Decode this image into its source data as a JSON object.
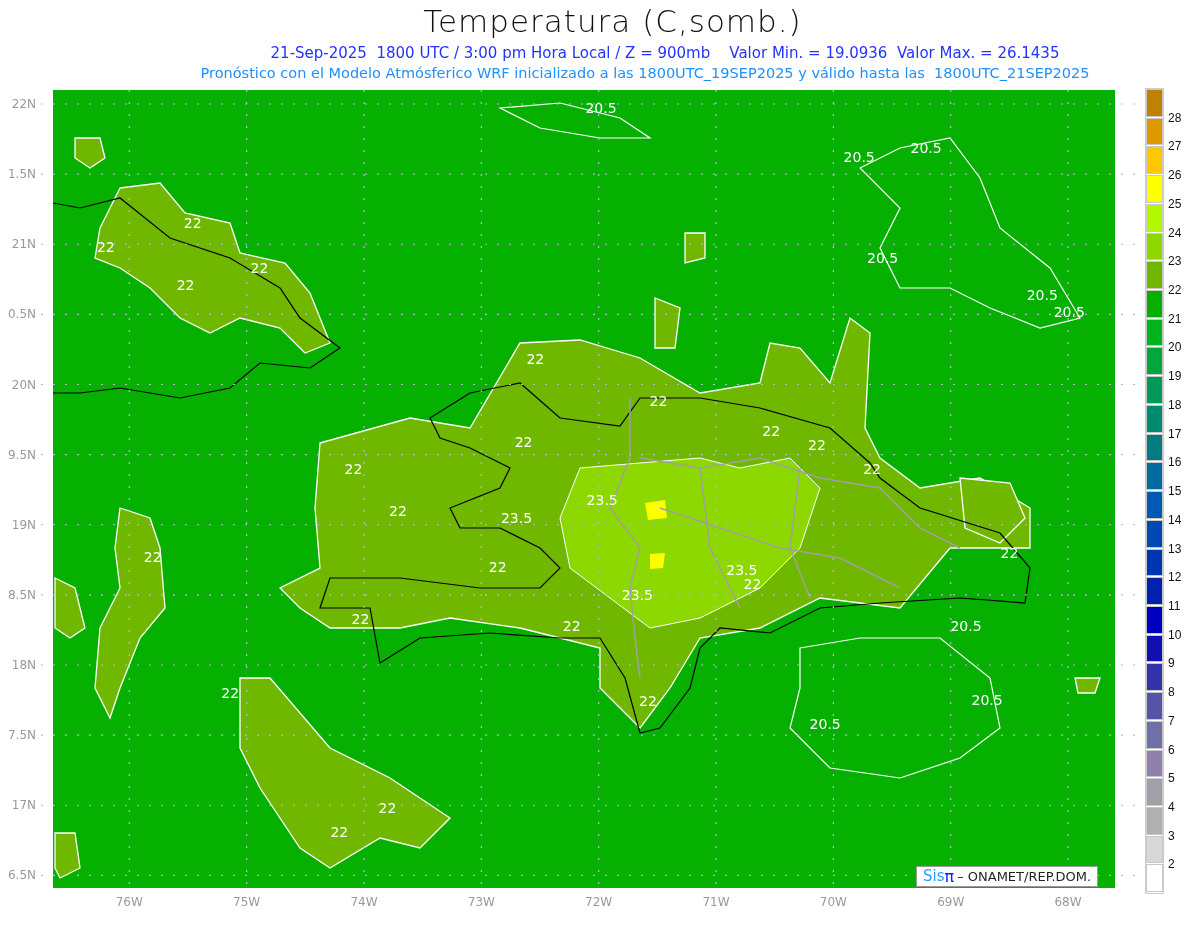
{
  "title": "Temperatura (C,somb.)",
  "subtitle": "21-Sep-2025  1800 UTC / 3:00 pm Hora Local / Z = 900mb    Valor Min. = 19.0936  Valor Max. = 26.1435",
  "note": "Pronóstico con el Modelo Atmósferico WRF inicializado a las 1800UTC_19SEP2025 y válido hasta las  1800UTC_21SEP2025",
  "map": {
    "lon_labels": [
      "76W",
      "75W",
      "74W",
      "73W",
      "72W",
      "71W",
      "70W",
      "69W",
      "68W"
    ],
    "lat_labels": [
      "22N",
      "1.5N",
      "21N",
      "0.5N",
      "20N",
      "9.5N",
      "19N",
      "8.5N",
      "18N",
      "7.5N",
      "17N",
      "6.5N"
    ],
    "contour_labels": [
      "20.5",
      "20.5",
      "20.5",
      "20.5",
      "20.5",
      "20.5",
      "22",
      "22",
      "22",
      "22",
      "22",
      "22",
      "22",
      "22",
      "22",
      "22",
      "22",
      "23.5",
      "22",
      "23.5",
      "22",
      "22",
      "22",
      "23.5",
      "22",
      "23.5",
      "22",
      "22",
      "20.5",
      "22",
      "20.5",
      "22",
      "20.5",
      "22",
      "22"
    ]
  },
  "colorbar": {
    "items": [
      {
        "color": "#c08000"
      },
      {
        "color": "#e09800",
        "label": "28"
      },
      {
        "color": "#ffc800",
        "label": "27"
      },
      {
        "color": "#ffff00",
        "label": "26"
      },
      {
        "color": "#b4f800",
        "label": "25"
      },
      {
        "color": "#8cd800",
        "label": "24"
      },
      {
        "color": "#70b800",
        "label": "23"
      },
      {
        "color": "#06b000",
        "label": "22"
      },
      {
        "color": "#00b41e",
        "label": "21"
      },
      {
        "color": "#00a83c",
        "label": "20"
      },
      {
        "color": "#00995a",
        "label": "19"
      },
      {
        "color": "#008a6e",
        "label": "18"
      },
      {
        "color": "#007c82",
        "label": "17"
      },
      {
        "color": "#006ca0",
        "label": "16"
      },
      {
        "color": "#005ab4",
        "label": "15"
      },
      {
        "color": "#0048b4",
        "label": "14"
      },
      {
        "color": "#0036b0",
        "label": "13"
      },
      {
        "color": "#0020b0",
        "label": "12"
      },
      {
        "color": "#0000c0",
        "label": "11"
      },
      {
        "color": "#1010b0",
        "label": "10"
      },
      {
        "color": "#3434a8",
        "label": "9"
      },
      {
        "color": "#5454a8",
        "label": "8"
      },
      {
        "color": "#7070a8",
        "label": "7"
      },
      {
        "color": "#9080b0",
        "label": "6"
      },
      {
        "color": "#a0a0a8",
        "label": "5"
      },
      {
        "color": "#b0b0b0",
        "label": "4"
      },
      {
        "color": "#d8d8d8",
        "label": "3"
      },
      {
        "color": "#ffffff",
        "label": "2"
      }
    ]
  },
  "logo": {
    "brand": "Sis",
    "symbol": "π",
    "text": "– ONAMET/REP.DOM."
  }
}
